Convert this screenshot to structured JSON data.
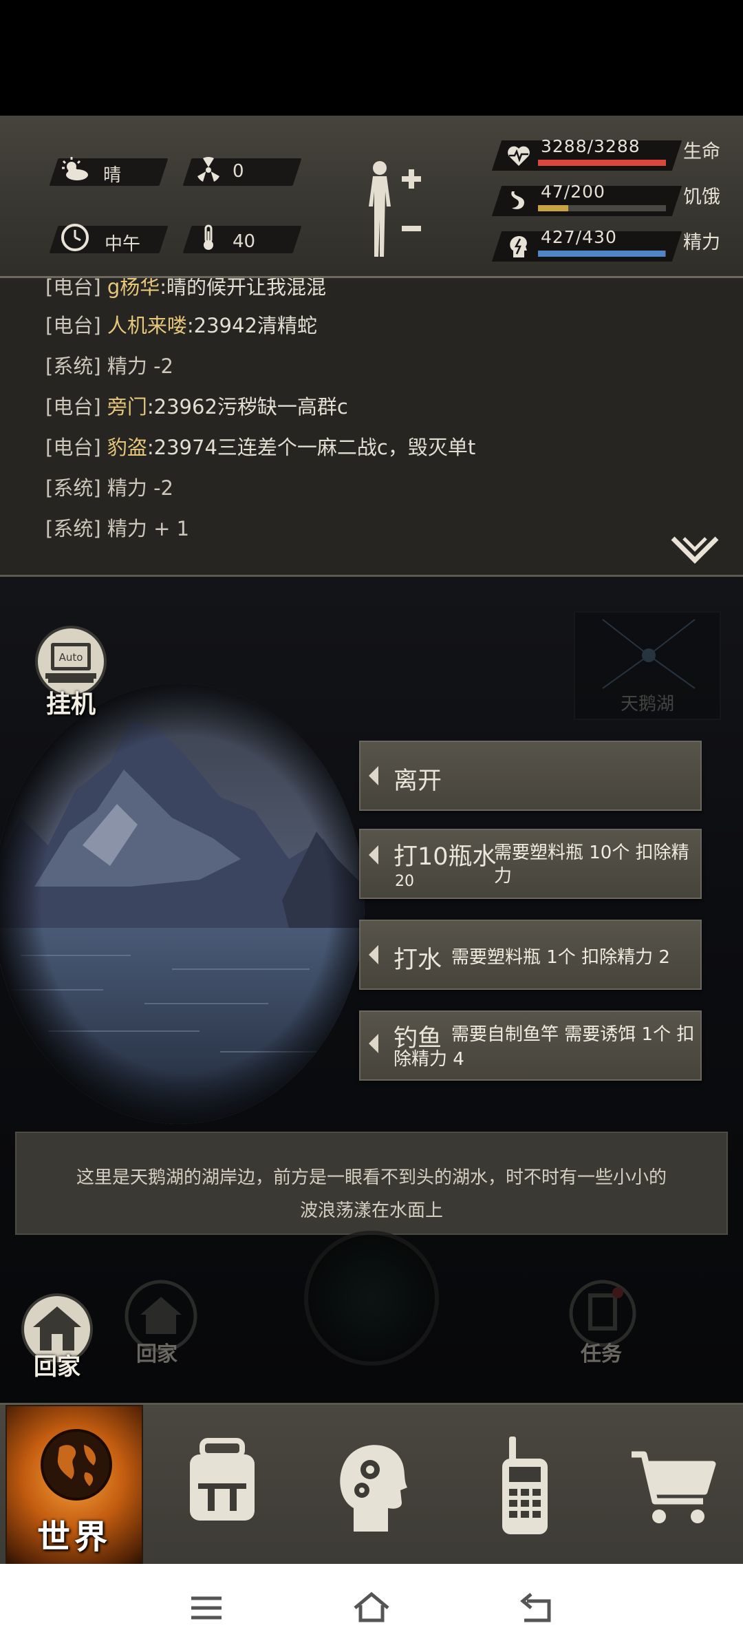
{
  "status": {
    "weather": "晴",
    "radiation": "0",
    "time_of_day": "中午",
    "temperature": "40"
  },
  "vitals": [
    {
      "icon": "heart-pulse-icon",
      "value": "3288/3288",
      "label": "生命",
      "fraction": 1.0,
      "color": "#d9473d"
    },
    {
      "icon": "stomach-icon",
      "value": "47/200",
      "label": "饥饿",
      "fraction": 0.235,
      "color": "#c9a341"
    },
    {
      "icon": "energy-head-icon",
      "value": "427/430",
      "label": "精力",
      "fraction": 0.993,
      "color": "#4f86c8"
    }
  ],
  "log": [
    {
      "tag": "[电台]",
      "name": "g杨华",
      "msg": ":晴的候开让我混混"
    },
    {
      "tag": "[电台]",
      "name": "人机来喽",
      "msg": ":23942清精蛇"
    },
    {
      "tag": "[系统]",
      "name": "",
      "msg": "精力 -2"
    },
    {
      "tag": "[电台]",
      "name": "旁门",
      "msg": ":23962污秽缺一高群c"
    },
    {
      "tag": "[电台]",
      "name": "豹盗",
      "msg": ":23974三连差个一麻二战c，毁灭单t"
    },
    {
      "tag": "[系统]",
      "name": "",
      "msg": "精力 -2"
    },
    {
      "tag": "[系统]",
      "name": "",
      "msg": "精力 + 1"
    }
  ],
  "scene": {
    "minimap_location": "天鹅湖",
    "auto_label": "挂机",
    "auto_badge": "Auto",
    "actions": [
      {
        "title": "离开",
        "desc": ""
      },
      {
        "title": "打10瓶水",
        "desc": "需要塑料瓶 10个 扣除精力",
        "desc2": "20"
      },
      {
        "title": "打水",
        "desc": "需要塑料瓶 1个 扣除精力 2",
        "desc2": ""
      },
      {
        "title": "钓鱼",
        "desc": "需要自制鱼竿 需要诱饵 1个 扣",
        "desc2": "除精力 4"
      }
    ],
    "description_line1": "这里是天鹅湖的湖岸边，前方是一眼看不到头的湖水，时不时有一些小小的",
    "description_line2": "波浪荡漾在水面上",
    "home_label": "回家",
    "ghost_home_label": "回家",
    "ghost_task_label": "任务"
  },
  "nav": {
    "world_label": "世界"
  }
}
